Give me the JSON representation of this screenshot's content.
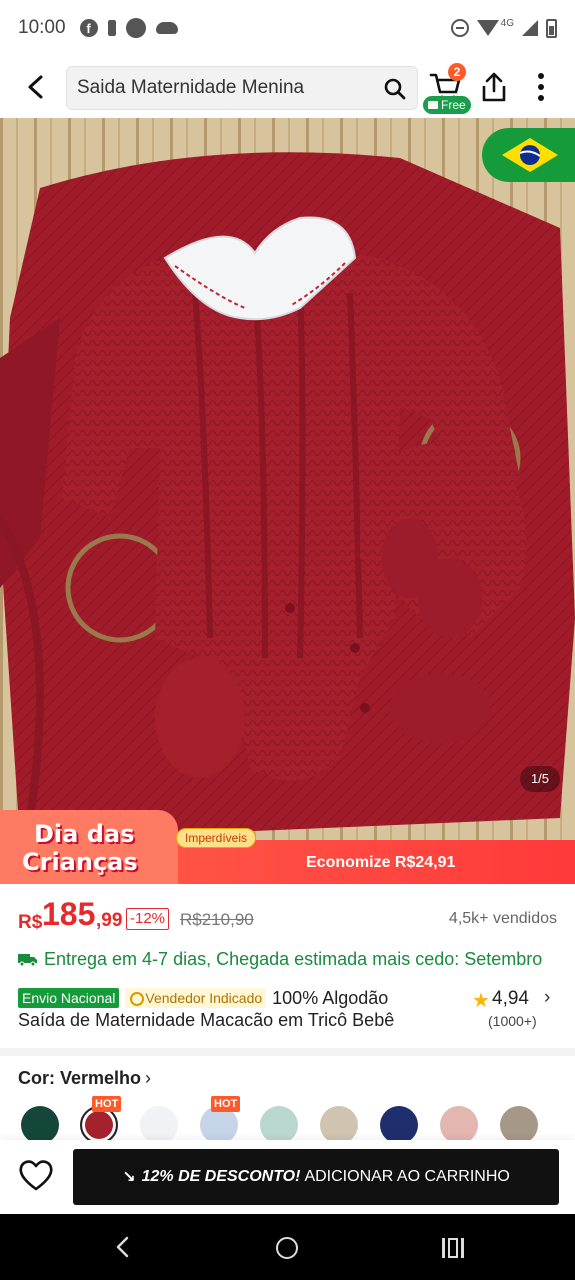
{
  "status_bar": {
    "time": "10:00",
    "network": "4G"
  },
  "header": {
    "search_value": "Saida Maternidade Menina",
    "cart_count": "2",
    "free_label": "Free"
  },
  "gallery": {
    "counter": "1/5"
  },
  "promo": {
    "title_line1": "Dia das",
    "title_line2": "Crianças",
    "tag": "Imperdíveis",
    "economize": "Economize R$24,91"
  },
  "price": {
    "currency": "R$",
    "main": "185",
    "cents": ",99",
    "discount": "-12%",
    "old_price": "R$210,90",
    "sold": "4,5k+ vendidos"
  },
  "delivery": {
    "text": "Entrega em 4-7 dias, Chegada estimada mais cedo: Setembro"
  },
  "badges": {
    "national": "Envio Nacional",
    "seller": "Vendedor Indicado",
    "material": "100% Algodão"
  },
  "product": {
    "title": "Saída de Maternidade Macacão em Tricô Bebê"
  },
  "rating": {
    "value": "4,94",
    "count": "(1000+)"
  },
  "color": {
    "label": "Cor: Vermelho",
    "hot_label": "HOT",
    "swatches": [
      {
        "name": "green",
        "color": "#14473a"
      },
      {
        "name": "red",
        "color": "#a4222e"
      },
      {
        "name": "white",
        "color": "#f1f2f5"
      },
      {
        "name": "light-blue",
        "color": "#c6d4ea"
      },
      {
        "name": "mint",
        "color": "#bad7cf"
      },
      {
        "name": "beige",
        "color": "#cfc4b0"
      },
      {
        "name": "navy",
        "color": "#1f2f6e"
      },
      {
        "name": "pink",
        "color": "#e3b6b0"
      },
      {
        "name": "taupe",
        "color": "#a69888"
      }
    ]
  },
  "actions": {
    "add_discount": "12% DE DESCONTO!",
    "add_label": "ADICIONAR AO CARRINHO"
  },
  "colors": {
    "price_red": "#e8282b",
    "delivery_green": "#198a3e",
    "promo_red": "#ff3a3a",
    "button_black": "#111111"
  }
}
